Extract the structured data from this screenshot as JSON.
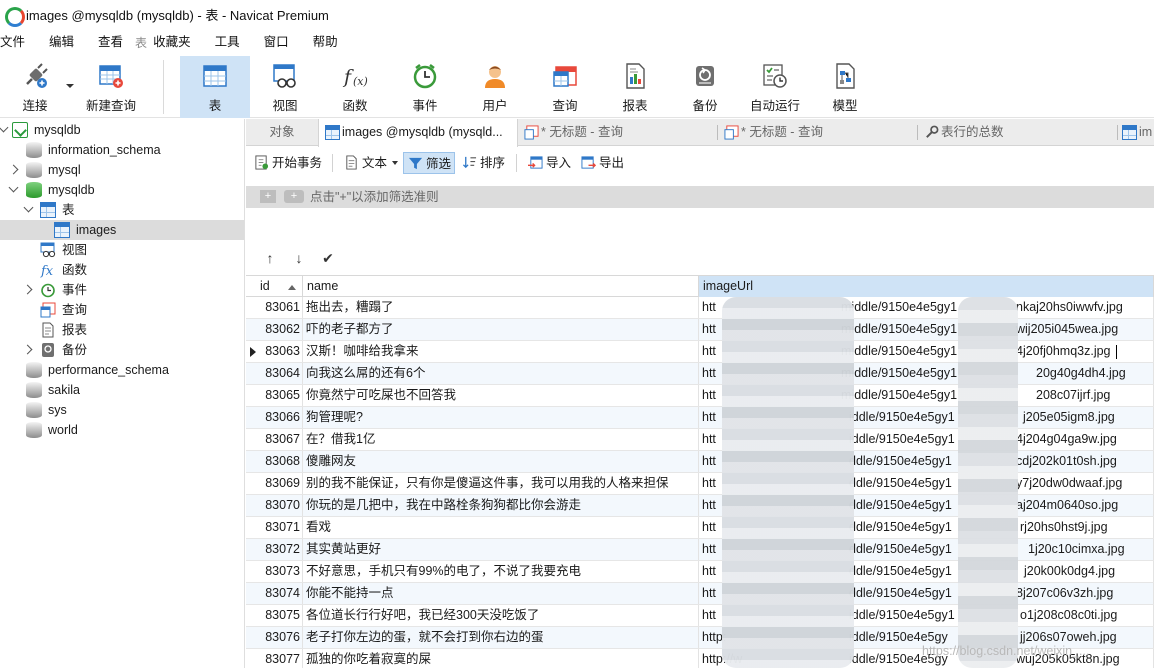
{
  "window": {
    "title": "images @mysqldb (mysqldb) - 表 - Navicat Premium"
  },
  "menu": {
    "items": [
      "文件",
      "编辑",
      "查看",
      "收藏夹",
      "工具",
      "窗口",
      "帮助"
    ],
    "separator_glyph": "表"
  },
  "ribbon": {
    "items": [
      {
        "label": "连接",
        "icon": "plug-icon"
      },
      {
        "label": "新建查询",
        "icon": "new-query-icon"
      },
      {
        "label": "表",
        "icon": "table-icon",
        "active": true
      },
      {
        "label": "视图",
        "icon": "view-icon"
      },
      {
        "label": "函数",
        "icon": "function-icon"
      },
      {
        "label": "事件",
        "icon": "clock-icon"
      },
      {
        "label": "用户",
        "icon": "user-icon"
      },
      {
        "label": "查询",
        "icon": "query-icon"
      },
      {
        "label": "报表",
        "icon": "report-icon"
      },
      {
        "label": "备份",
        "icon": "backup-icon"
      },
      {
        "label": "自动运行",
        "icon": "autorun-icon"
      },
      {
        "label": "模型",
        "icon": "model-icon"
      }
    ]
  },
  "sidebar": {
    "root": "mysqldb",
    "items": [
      {
        "label": "information_schema",
        "kind": "db"
      },
      {
        "label": "mysql",
        "kind": "db"
      },
      {
        "label": "mysqldb",
        "kind": "db-open"
      },
      {
        "label": "表",
        "kind": "group-tables"
      },
      {
        "label": "images",
        "kind": "table",
        "selected": true
      },
      {
        "label": "视图",
        "kind": "group-views"
      },
      {
        "label": "函数",
        "kind": "group-functions"
      },
      {
        "label": "事件",
        "kind": "group-events"
      },
      {
        "label": "查询",
        "kind": "group-queries"
      },
      {
        "label": "报表",
        "kind": "group-reports"
      },
      {
        "label": "备份",
        "kind": "group-backups"
      },
      {
        "label": "performance_schema",
        "kind": "db"
      },
      {
        "label": "sakila",
        "kind": "db"
      },
      {
        "label": "sys",
        "kind": "db"
      },
      {
        "label": "world",
        "kind": "db"
      }
    ]
  },
  "tabs": [
    {
      "label": "对象"
    },
    {
      "label": "images @mysqldb (mysqld..."
    },
    {
      "label": "* 无标题 - 查询"
    },
    {
      "label": "* 无标题 - 查询"
    },
    {
      "label": "表行的总数"
    },
    {
      "label": "im"
    }
  ],
  "object_toolbar": {
    "begin_tx": "开始事务",
    "text": "文本",
    "filter": "筛选",
    "sort": "排序",
    "import": "导入",
    "export": "导出"
  },
  "filter": {
    "hint": "点击\"+\"以添加筛选准则",
    "add": "+",
    "add2": "+"
  },
  "grid": {
    "columns": [
      "id",
      "name",
      "imageUrl"
    ],
    "current_row": 2,
    "rows": [
      {
        "id": "83061",
        "name": "拖出去，糟蹋了",
        "url_prefix": "htt",
        "url_mid": "middle/9150e4e5gy1",
        "url_suffix": "nkaj20hs0iwwfv.jpg"
      },
      {
        "id": "83062",
        "name": "吓的老子都方了",
        "url_prefix": "htt",
        "url_mid": "middle/9150e4e5gy1",
        "url_suffix": "wij205i045wea.jpg"
      },
      {
        "id": "83063",
        "name": "汉斯！咖啡给我拿来",
        "url_prefix": "htt",
        "url_mid": "middle/9150e4e5gy1",
        "url_suffix": "4j20fj0hmq3z.jpg"
      },
      {
        "id": "83064",
        "name": "向我这么屌的还有6个",
        "url_prefix": "htt",
        "url_mid": "middle/9150e4e5gy1",
        "url_suffix": "20g40g4dh4.jpg"
      },
      {
        "id": "83065",
        "name": "你竟然宁可吃屎也不回答我",
        "url_prefix": "htt",
        "url_mid": "middle/9150e4e5gy1",
        "url_suffix": "208c07ijrf.jpg"
      },
      {
        "id": "83066",
        "name": "狗管理呢?",
        "url_prefix": "htt",
        "url_mid": "iddle/9150e4e5gy1",
        "url_suffix": "j205e05igm8.jpg"
      },
      {
        "id": "83067",
        "name": "在？借我1亿",
        "url_prefix": "htt",
        "url_mid": "iddle/9150e4e5gy1",
        "url_suffix": "4j204g04ga9w.jpg"
      },
      {
        "id": "83068",
        "name": "傻雕网友",
        "url_prefix": "htt",
        "url_mid": "ddle/9150e4e5gy1",
        "url_suffix": "cdj202k01t0sh.jpg"
      },
      {
        "id": "83069",
        "name": "别的我不能保证，只有你是傻逼这件事，我可以用我的人格来担保",
        "url_prefix": "htt",
        "url_mid": "ddle/9150e4e5gy1",
        "url_suffix": "y7j20dw0dwaaf.jpg"
      },
      {
        "id": "83070",
        "name": "你玩的是几把中，我在中路栓条狗狗都比你会游走",
        "url_prefix": "htt",
        "url_mid": "ddle/9150e4e5gy1",
        "url_suffix": "aj204m0640so.jpg"
      },
      {
        "id": "83071",
        "name": "看戏",
        "url_prefix": "htt",
        "url_mid": "ddle/9150e4e5gy1",
        "url_suffix": "rj20hs0hst9j.jpg"
      },
      {
        "id": "83072",
        "name": "其实黄站更好",
        "url_prefix": "htt",
        "url_mid": "ddle/9150e4e5gy1",
        "url_suffix": "1j20c10cimxa.jpg"
      },
      {
        "id": "83073",
        "name": "不好意思，手机只有99%的电了，不说了我要充电",
        "url_prefix": "htt",
        "url_mid": "ddle/9150e4e5gy1",
        "url_suffix": "j20k00k0dg4.jpg"
      },
      {
        "id": "83074",
        "name": "你能不能持一点",
        "url_prefix": "htt",
        "url_mid": "ddle/9150e4e5gy1",
        "url_suffix": "8j207c06v3zh.jpg"
      },
      {
        "id": "83075",
        "name": "各位道长行行好吧，我已经300天没吃饭了",
        "url_prefix": "htt",
        "url_mid": "iddle/9150e4e5gy1",
        "url_suffix": "o1j208c08c0ti.jpg"
      },
      {
        "id": "83076",
        "name": "老子打你左边的蛋，就不会打到你右边的蛋",
        "url_prefix": "http:",
        "url_mid": "iddle/9150e4e5gy",
        "url_suffix": "jj206s07oweh.jpg"
      },
      {
        "id": "83077",
        "name": "孤独的你吃着寂寞的屎",
        "url_prefix": "http://w",
        "url_mid": "iddle/9150e4e5gy",
        "url_suffix": "wuj205k05kt8n.jpg"
      }
    ]
  },
  "watermark": "https://blog.csdn.net/weixin_...",
  "colors": {
    "ribbon_active": "#cfe3f6",
    "selection": "#dcdcdc",
    "accent": "#2f78c8"
  }
}
